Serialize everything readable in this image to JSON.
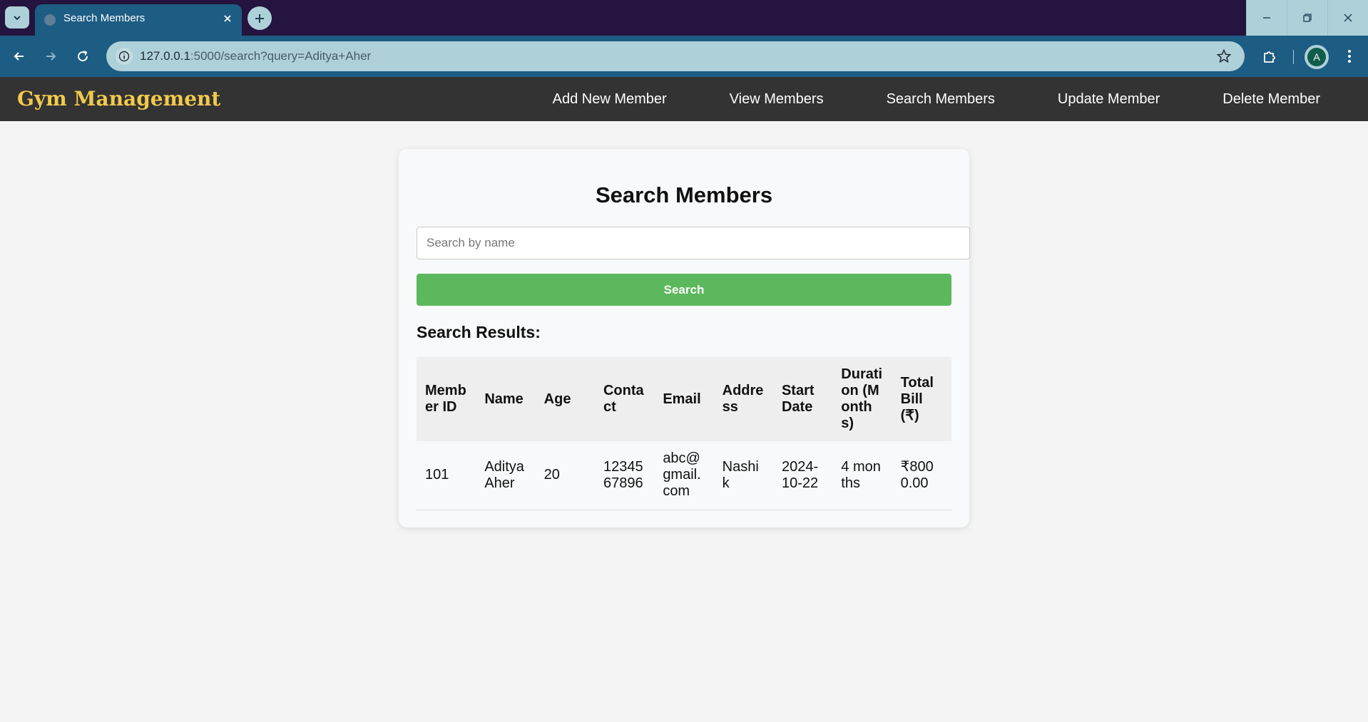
{
  "browser": {
    "tab_title": "Search Members",
    "url_host": "127.0.0.1",
    "url_path": ":5000/search?query=Aditya+Aher",
    "avatar_initial": "A"
  },
  "site": {
    "brand": "Gym Management",
    "nav": [
      "Add New Member",
      "View Members",
      "Search Members",
      "Update Member",
      "Delete Member"
    ]
  },
  "page": {
    "title": "Search Members",
    "search_placeholder": "Search by name",
    "search_value": "",
    "search_button": "Search",
    "results_heading": "Search Results:"
  },
  "table": {
    "headers": [
      "Member ID",
      "Name",
      "Age",
      "Contact",
      "Email",
      "Address",
      "Start Date",
      "Duration (Months)",
      "Total Bill (₹)"
    ],
    "rows": [
      [
        "101",
        "Aditya Aher",
        "20",
        "1234567896",
        "abc@gmail.com",
        "Nashik",
        "2024-10-22",
        "4 months",
        "₹8000.00"
      ]
    ]
  },
  "colors": {
    "brand": "#f2c94c",
    "nav_bg": "#333333",
    "search_button": "#5cb85c"
  }
}
